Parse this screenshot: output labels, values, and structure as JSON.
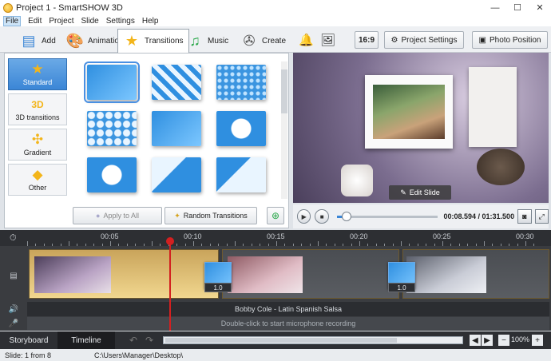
{
  "window": {
    "title": "Project 1 - SmartSHOW 3D"
  },
  "menu": [
    "File",
    "Edit",
    "Project",
    "Slide",
    "Settings",
    "Help"
  ],
  "tabs": [
    {
      "label": "Add",
      "icon": "folder-icon"
    },
    {
      "label": "Animation",
      "icon": "palette-icon"
    },
    {
      "label": "Transitions",
      "icon": "star-icon"
    },
    {
      "label": "Music",
      "icon": "music-note-icon"
    },
    {
      "label": "Create",
      "icon": "film-reel-icon"
    }
  ],
  "toolbar": {
    "aspect": "16:9",
    "project_settings": "Project Settings",
    "photo_position": "Photo Position"
  },
  "categories": [
    {
      "label": "Standard",
      "icon": "star-icon"
    },
    {
      "label": "3D transitions",
      "icon": "3d-icon"
    },
    {
      "label": "Gradient",
      "icon": "gradient-icon"
    },
    {
      "label": "Other",
      "icon": "cube-icon"
    }
  ],
  "transitions_panel": {
    "apply_all": "Apply to All",
    "random": "Random Transitions"
  },
  "preview": {
    "edit_slide": "Edit Slide",
    "time": "00:08.594 / 01:31.500",
    "progress": 0.094
  },
  "timeline": {
    "ruler": [
      "00:05",
      "00:10",
      "00:15",
      "00:20",
      "00:25",
      "00:30"
    ],
    "transition_durations": [
      "1.0",
      "1.0"
    ],
    "audio_track": "Bobby Cole - Latin Spanish Salsa",
    "mic_hint": "Double-click to start microphone recording"
  },
  "bottom": {
    "storyboard": "Storyboard",
    "timeline": "Timeline",
    "zoom": "100%"
  },
  "status": {
    "slide": "Slide: 1 from 8",
    "path": "C:\\Users\\Manager\\Desktop\\"
  }
}
